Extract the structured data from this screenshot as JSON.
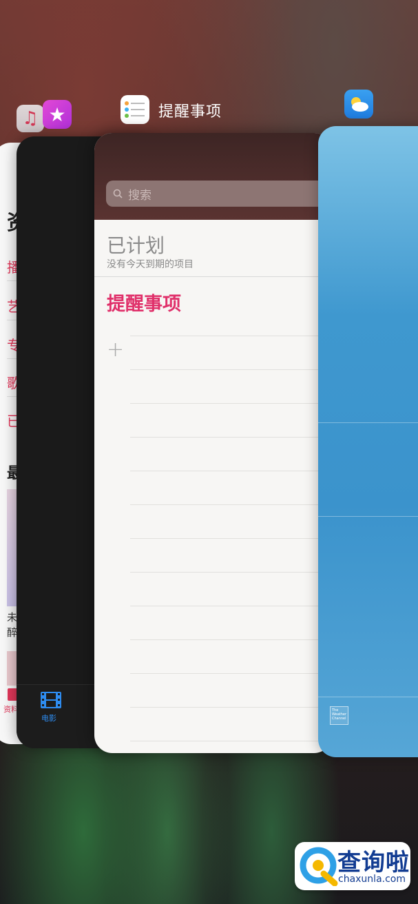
{
  "header": {
    "title": "提醒事项",
    "icons": [
      "music-icon",
      "itunes-star-icon",
      "reminders-icon",
      "weather-icon"
    ]
  },
  "music_card": {
    "title_partial": "资",
    "items": [
      "播",
      "艺",
      "专",
      "歌",
      "已"
    ],
    "recent_partial": "最",
    "song_lines": [
      "未",
      "醉"
    ],
    "tab_label_partial": "资料"
  },
  "itunes_card": {
    "tab_label": "电影",
    "accent_color": "#2e8cf0"
  },
  "reminders_card": {
    "search_placeholder": "搜索",
    "scheduled_title": "已计划",
    "scheduled_subtitle": "没有今天到期的项目",
    "list_title": "提醒事项",
    "add_symbol": "+",
    "accent_color": "#e0306a"
  },
  "weather_card": {
    "logo_text": "The Weather Channel"
  },
  "watermark": {
    "name": "查询啦",
    "url": "chaxunla.com"
  }
}
